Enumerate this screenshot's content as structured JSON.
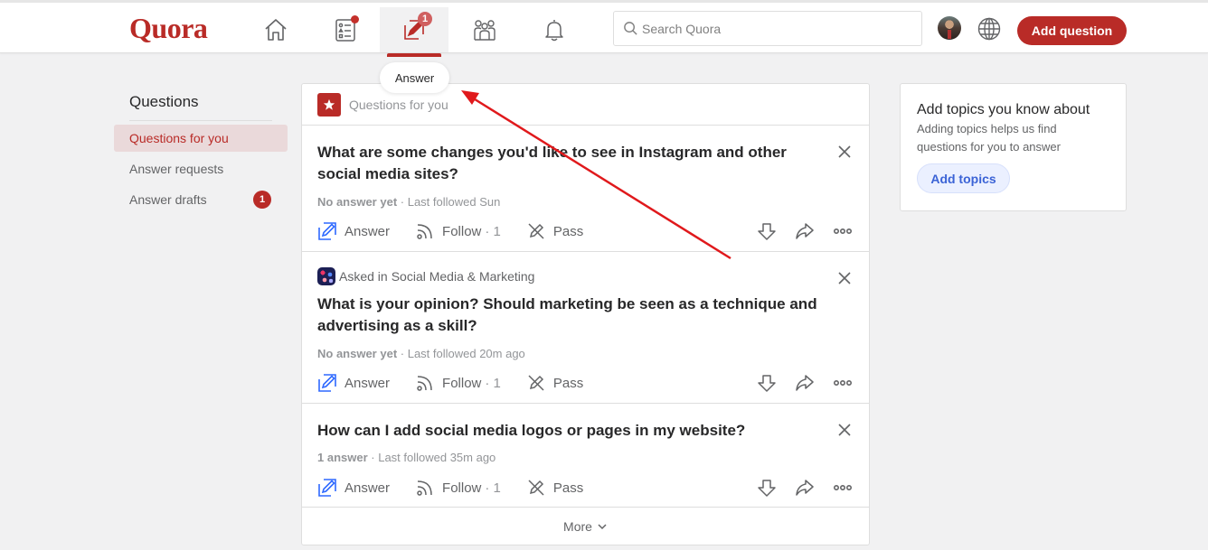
{
  "header": {
    "logo": "Quora",
    "nav": [
      {
        "name": "home",
        "icon": "home-icon"
      },
      {
        "name": "following",
        "icon": "list-icon",
        "has_dot": true
      },
      {
        "name": "answer",
        "icon": "edit-icon",
        "badge": "1",
        "active": true
      },
      {
        "name": "spaces",
        "icon": "people-icon"
      },
      {
        "name": "notifications",
        "icon": "bell-icon"
      }
    ],
    "search_placeholder": "Search Quora",
    "add_question_label": "Add question"
  },
  "tooltip": "Answer",
  "sidebar": {
    "title": "Questions",
    "items": [
      {
        "label": "Questions for you",
        "active": true
      },
      {
        "label": "Answer requests"
      },
      {
        "label": "Answer drafts",
        "badge": "1"
      }
    ]
  },
  "feed": {
    "header_label": "Questions for you",
    "questions": [
      {
        "title": "What are some changes you'd like to see in Instagram and other social media sites?",
        "status": "No answer yet",
        "meta": " · Last followed Sun"
      },
      {
        "asked_prefix": "Asked in",
        "topic": "Social Media & Marketing",
        "title": "What is your opinion? Should marketing be seen as a technique and advertising as a skill?",
        "status": "No answer yet",
        "meta": " · Last followed 20m ago"
      },
      {
        "title": "How can I add social media logos or pages in my website?",
        "status": "1 answer",
        "meta": " · Last followed 35m ago"
      }
    ],
    "actions": {
      "answer": "Answer",
      "follow": "Follow",
      "follow_count": "· 1",
      "pass": "Pass"
    },
    "more_label": "More"
  },
  "topics_card": {
    "title": "Add topics you know about",
    "subtitle": "Adding topics helps us find questions for you to answer",
    "button": "Add topics"
  },
  "colors": {
    "brand": "#b92b27",
    "answer_icon": "#2e69ff",
    "annotation_arrow": "#e0191c"
  }
}
